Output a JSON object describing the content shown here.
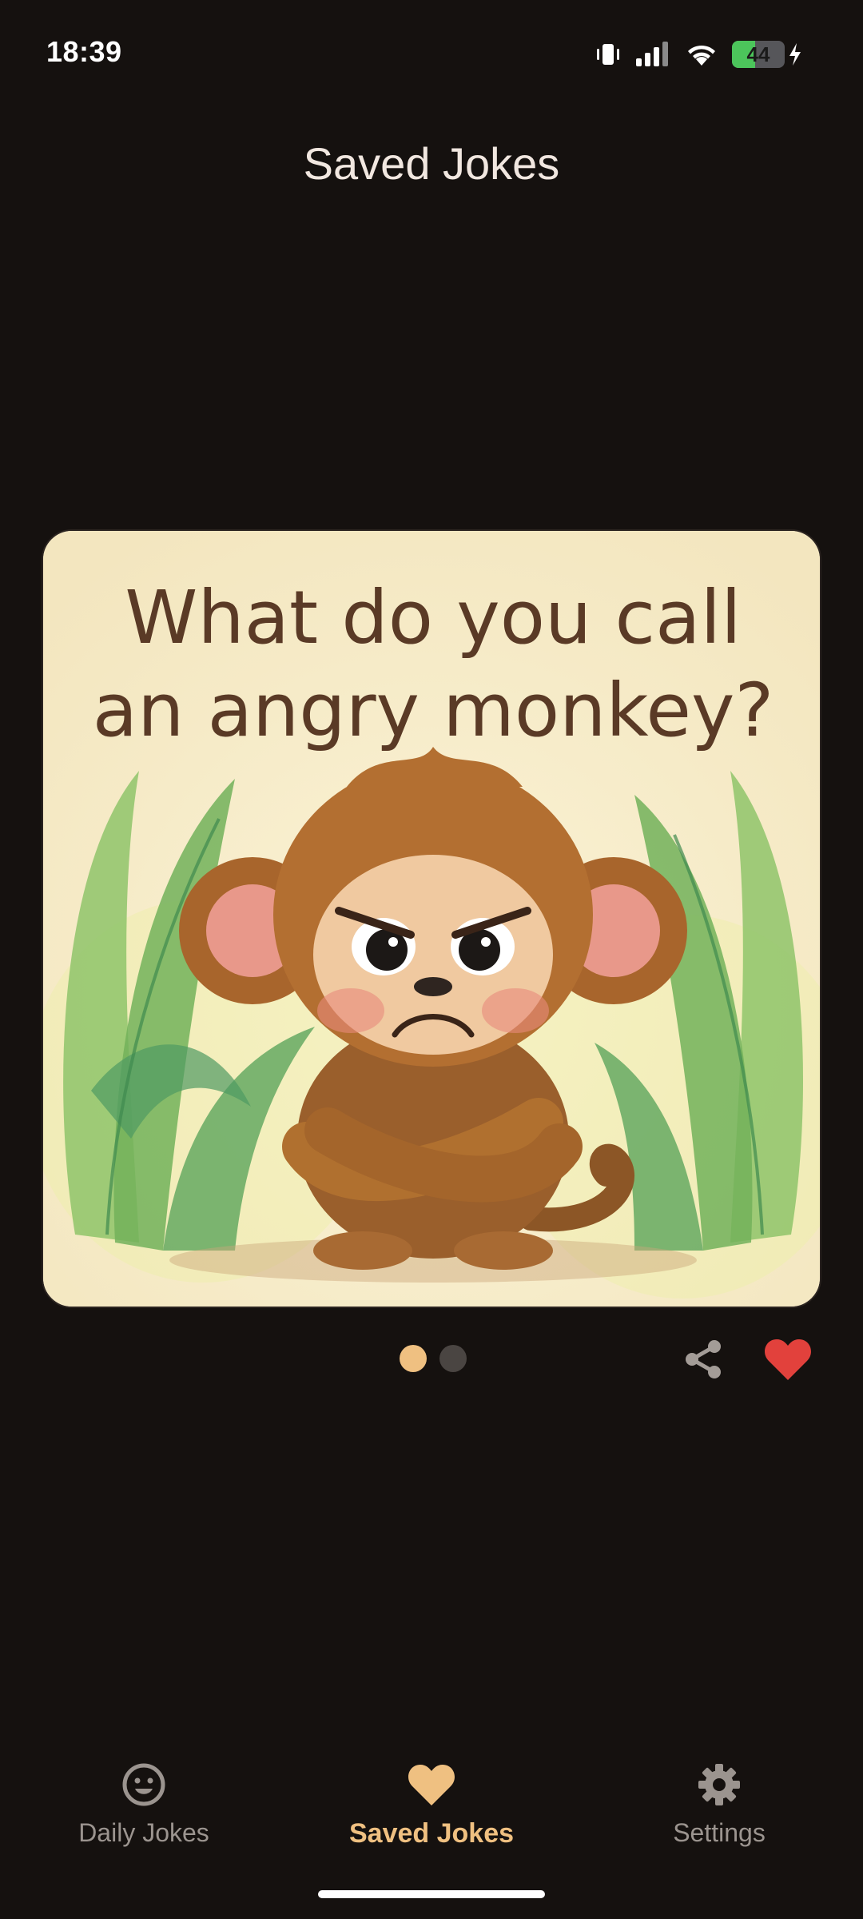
{
  "status_bar": {
    "time": "18:39",
    "battery_level": "44",
    "battery_fraction": 0.44,
    "icons": [
      "vibrate-icon",
      "signal-icon",
      "wifi-icon",
      "battery-icon",
      "charging-icon"
    ]
  },
  "header": {
    "title": "Saved Jokes"
  },
  "joke": {
    "setup_line_1": "What do you call",
    "setup_line_2": "an angry monkey?",
    "illustration": "angry-monkey-illustration",
    "page_index": 0,
    "page_count": 2
  },
  "actions": {
    "share_icon": "share-icon",
    "favorite_icon": "heart-icon",
    "favorite_color": "#e2413c"
  },
  "bottom_nav": {
    "items": [
      {
        "label": "Daily Jokes",
        "icon": "smiley-icon",
        "active": false
      },
      {
        "label": "Saved Jokes",
        "icon": "heart-icon",
        "active": true
      },
      {
        "label": "Settings",
        "icon": "gear-icon",
        "active": false
      }
    ]
  },
  "colors": {
    "background": "#15110f",
    "accent": "#efc081",
    "inactive": "#9b948f"
  }
}
